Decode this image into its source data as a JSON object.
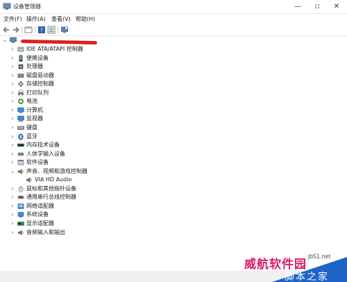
{
  "window": {
    "title": "设备管理器"
  },
  "menu": [
    {
      "label": "文件(F)"
    },
    {
      "label": "操作(A)"
    },
    {
      "label": "查看(V)"
    },
    {
      "label": "帮助(H)"
    }
  ],
  "tree": {
    "items": [
      {
        "label": "IDE ATA/ATAPI 控制器",
        "icon": "ide-controller-icon",
        "expanded": false
      },
      {
        "label": "便携设备",
        "icon": "portable-device-icon",
        "expanded": false
      },
      {
        "label": "处理器",
        "icon": "processor-icon",
        "expanded": false
      },
      {
        "label": "磁盘驱动器",
        "icon": "disk-drive-icon",
        "expanded": false
      },
      {
        "label": "存储控制器",
        "icon": "storage-controller-icon",
        "expanded": false
      },
      {
        "label": "打印队列",
        "icon": "printer-icon",
        "expanded": false
      },
      {
        "label": "电池",
        "icon": "battery-icon",
        "expanded": false
      },
      {
        "label": "计算机",
        "icon": "computer-icon",
        "expanded": false
      },
      {
        "label": "监视器",
        "icon": "monitor-icon",
        "expanded": false
      },
      {
        "label": "键盘",
        "icon": "keyboard-icon",
        "expanded": false
      },
      {
        "label": "蓝牙",
        "icon": "bluetooth-icon",
        "expanded": false
      },
      {
        "label": "内存技术设备",
        "icon": "memory-device-icon",
        "expanded": false
      },
      {
        "label": "人体学输入设备",
        "icon": "hid-icon",
        "expanded": false
      },
      {
        "label": "软件设备",
        "icon": "software-device-icon",
        "expanded": false
      },
      {
        "label": "声音、视频和游戏控制器",
        "icon": "speaker-icon",
        "expanded": true,
        "children": [
          {
            "label": "VIA HD Audio",
            "icon": "speaker-icon"
          }
        ]
      },
      {
        "label": "鼠标和其他指针设备",
        "icon": "mouse-icon",
        "expanded": false
      },
      {
        "label": "通用串行总线控制器",
        "icon": "usb-icon",
        "expanded": false
      },
      {
        "label": "网络适配器",
        "icon": "network-adapter-icon",
        "expanded": false
      },
      {
        "label": "系统设备",
        "icon": "system-device-icon",
        "expanded": false
      },
      {
        "label": "显示适配器",
        "icon": "display-adapter-icon",
        "expanded": false
      },
      {
        "label": "音频输入和输出",
        "icon": "audio-io-icon",
        "expanded": false
      }
    ]
  },
  "watermark": {
    "site": "jb51.net",
    "brand": "威航软件园",
    "tagline": "脚本之家"
  },
  "colors": {
    "accent_red": "#e02020",
    "watermark_pink": "#d81e6a",
    "watermark_blue": "#1e63c8"
  }
}
